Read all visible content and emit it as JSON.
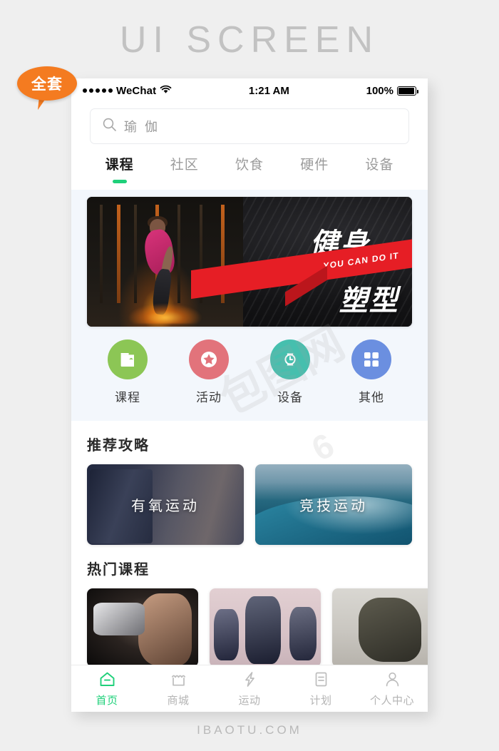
{
  "poster": {
    "title": "UI SCREEN",
    "footer": "IBAOTU.COM",
    "badge": "全套"
  },
  "statusbar": {
    "carrier": "WeChat",
    "signal_dots": 5,
    "wifi_icon": "wifi-icon",
    "time": "1:21 AM",
    "battery_percent": "100%",
    "battery_icon": "battery-full-icon"
  },
  "search": {
    "icon": "search-icon",
    "value": "瑜 伽",
    "placeholder": "瑜 伽"
  },
  "tabs": {
    "active_index": 0,
    "items": [
      {
        "label": "课程"
      },
      {
        "label": "社区"
      },
      {
        "label": "饮食"
      },
      {
        "label": "硬件"
      },
      {
        "label": "设备"
      }
    ]
  },
  "banner": {
    "title_cn": "健身",
    "subtitle_en": "YOU CAN DO IT",
    "title_cn2": "塑型",
    "ribbon_color": "#e61e25"
  },
  "quick_actions": [
    {
      "label": "课程",
      "icon": "book-icon",
      "color": "#8cc655"
    },
    {
      "label": "活动",
      "icon": "star-badge-icon",
      "color": "#e2737b"
    },
    {
      "label": "设备",
      "icon": "smartwatch-icon",
      "color": "#46bfae"
    },
    {
      "label": "其他",
      "icon": "grid-icon",
      "color": "#6b8fe0"
    }
  ],
  "guides": {
    "title": "推荐攻略",
    "cards": [
      {
        "label": "有氧运动"
      },
      {
        "label": "竞技运动"
      }
    ]
  },
  "courses": {
    "title": "热门课程",
    "cards": [
      {
        "name": "dumbbell-course"
      },
      {
        "name": "dance-course"
      },
      {
        "name": "running-course"
      }
    ]
  },
  "tabbar": {
    "active_index": 0,
    "accent": "#1fd07a",
    "items": [
      {
        "label": "首页",
        "icon": "home-icon"
      },
      {
        "label": "商城",
        "icon": "shop-icon"
      },
      {
        "label": "运动",
        "icon": "lightning-icon"
      },
      {
        "label": "计划",
        "icon": "document-icon"
      },
      {
        "label": "个人中心",
        "icon": "person-icon"
      }
    ]
  }
}
